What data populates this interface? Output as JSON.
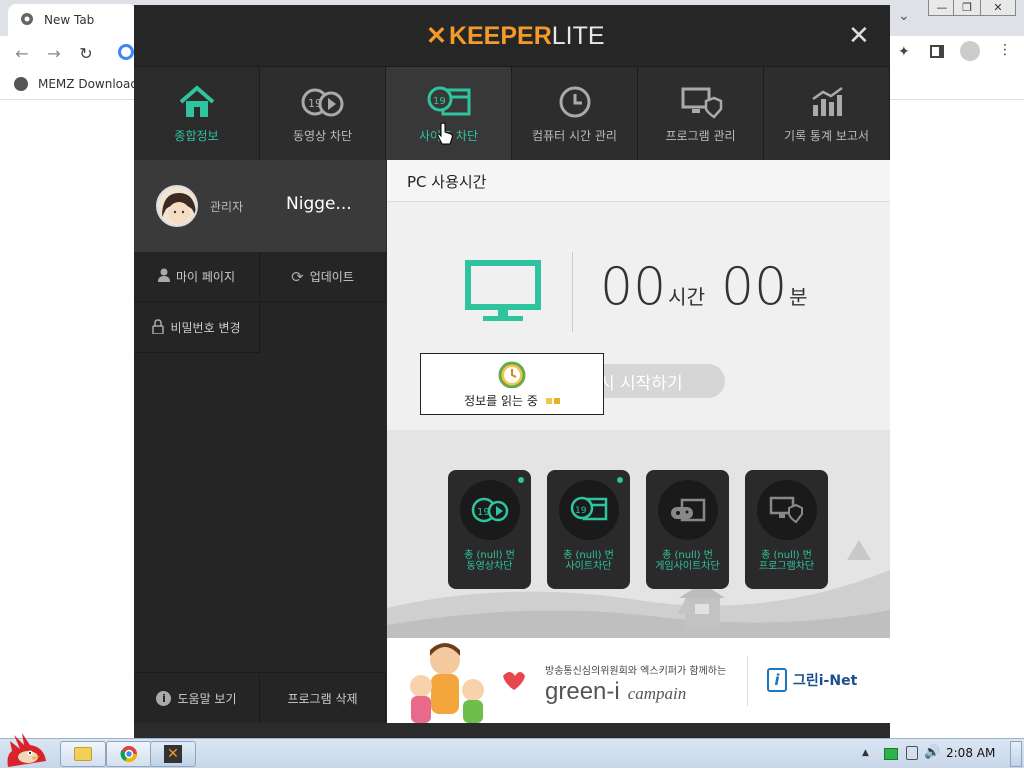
{
  "chrome": {
    "tab_title": "New Tab",
    "bookmark": "MEMZ Download",
    "minimize": "—",
    "restore": "❐",
    "close": "✕",
    "overflow": "⌄"
  },
  "keeper": {
    "logo_x": "✕",
    "logo_main": "KEEPER",
    "logo_sub": "LITE",
    "close": "✕",
    "nav": [
      {
        "label": "종합정보",
        "icon": "home-icon"
      },
      {
        "label": "동영상 차단",
        "icon": "video-block-icon"
      },
      {
        "label": "사이트 차단",
        "icon": "site-block-icon"
      },
      {
        "label": "컴퓨터 시간 관리",
        "icon": "clock-icon"
      },
      {
        "label": "프로그램 관리",
        "icon": "program-icon"
      },
      {
        "label": "기록 통계 보고서",
        "icon": "chart-icon"
      }
    ],
    "profile": {
      "role": "관리자",
      "name": "Nigge..."
    },
    "sidebar": {
      "mypage": "마이 페이지",
      "update": "업데이트",
      "password": "비밀번호 변경",
      "help": "도움말 보기",
      "uninstall": "프로그램 삭제"
    },
    "usage": {
      "heading": "PC 사용시간",
      "hours": "00",
      "hours_unit": "시간",
      "minutes": "00",
      "minutes_unit": "분",
      "start_btn": "시 시작하기"
    },
    "cards": [
      {
        "line1": "총 (null) 번",
        "line2": "동영상차단",
        "dot": true
      },
      {
        "line1": "총 (null) 번",
        "line2": "사이트차단",
        "dot": true
      },
      {
        "line1": "총 (null) 번",
        "line2": "게임사이트차단",
        "dot": false
      },
      {
        "line1": "총 (null) 번",
        "line2": "프로그램차단",
        "dot": false
      }
    ],
    "banner": {
      "small": "방송통신심의위원회와 엑스키퍼가 함께하는",
      "big": "green-i",
      "script": "campain",
      "logo": "그린i-Net"
    },
    "loading": "정보를 읽는 중"
  },
  "taskbar": {
    "time": "2:08 AM"
  },
  "colors": {
    "accent": "#2ec4a0",
    "logo_orange": "#f39a2b"
  }
}
